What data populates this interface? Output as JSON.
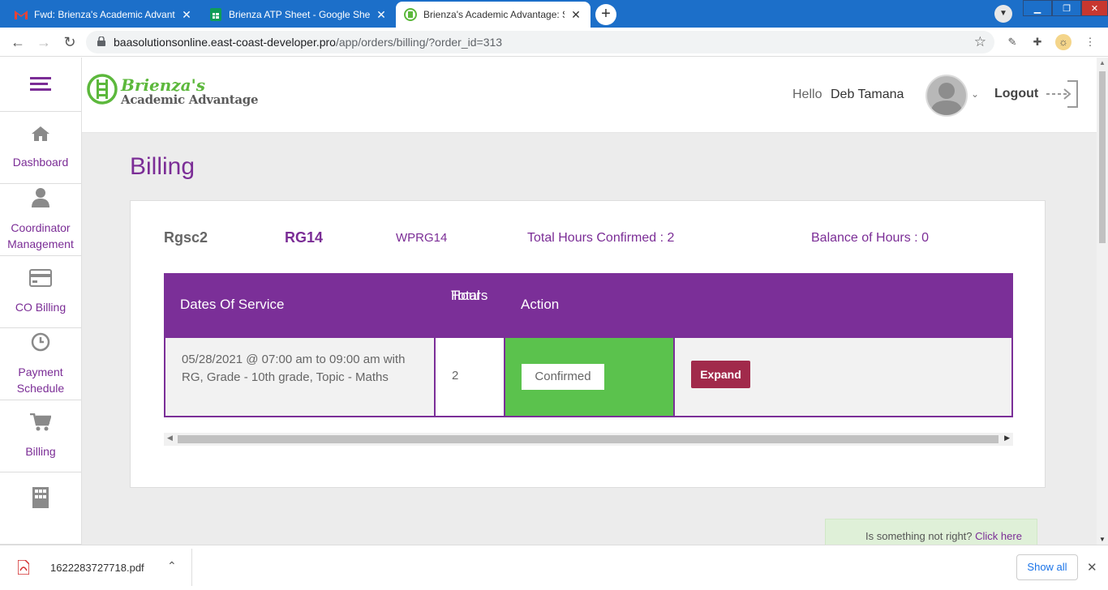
{
  "browser": {
    "tabs": [
      {
        "title": "Fwd: Brienza's Academic Advanta",
        "icon": "gmail-icon"
      },
      {
        "title": "Brienza ATP Sheet - Google Shee",
        "icon": "sheets-icon"
      },
      {
        "title": "Brienza's Academic Advantage: S",
        "icon": "brienza-icon",
        "active": true
      }
    ],
    "url_host": "baasolutionsonline.east-coast-developer.pro",
    "url_path": "/app/orders/billing/?order_id=313"
  },
  "sidebar": {
    "items": [
      {
        "label": "Dashboard",
        "icon": "home-icon"
      },
      {
        "label": "Coordinator Management",
        "icon": "user-icon"
      },
      {
        "label": "CO Billing",
        "icon": "credit-card-icon"
      },
      {
        "label": "Payment Schedule",
        "icon": "clock-icon"
      },
      {
        "label": "Billing",
        "icon": "cart-icon"
      },
      {
        "label": "",
        "icon": "building-icon"
      }
    ]
  },
  "header": {
    "logo_line1": "Brienza's",
    "logo_line2": "Academic Advantage",
    "hello": "Hello",
    "user_name": "Deb Tamana",
    "logout": "Logout"
  },
  "page": {
    "title": "Billing",
    "meta": {
      "code1": "Rgsc2",
      "code2": "RG14",
      "code3": "WPRG14",
      "total_hours": "Total Hours Confirmed : 2",
      "balance": "Balance of Hours : 0"
    },
    "table": {
      "headers": {
        "dates": "Dates Of Service",
        "hours_line1": "Total",
        "hours_line2": "Hours",
        "action": "Action"
      },
      "rows": [
        {
          "date": "05/28/2021 @ 07:00 am to 09:00 am with RG, Grade - 10th grade, Topic - Maths",
          "hours": "2",
          "status": "Confirmed",
          "expand": "Expand"
        }
      ]
    },
    "feedback": {
      "text": "Is something not right? ",
      "link": "Click here"
    }
  },
  "downloads": {
    "file": "1622283727718.pdf",
    "show_all": "Show all"
  },
  "colors": {
    "brand_purple": "#7b2f98",
    "confirmed_green": "#5bc24d",
    "expand_red": "#a12a4b",
    "logo_green": "#5cb83c"
  }
}
